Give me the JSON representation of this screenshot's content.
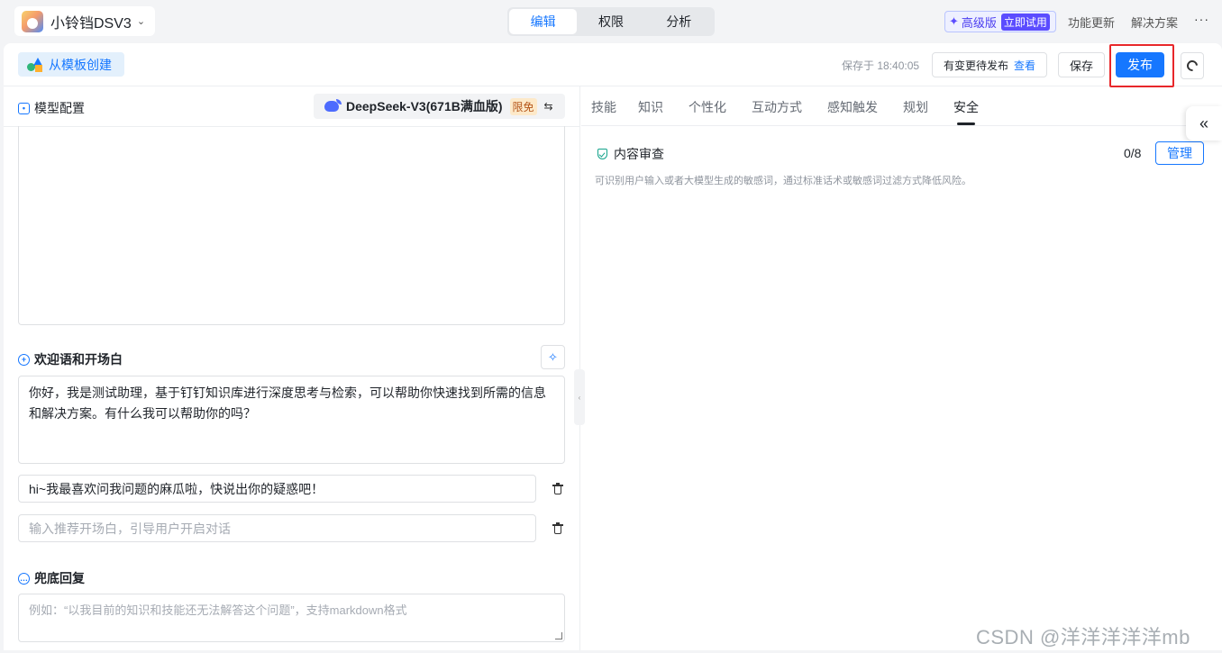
{
  "app": {
    "name": "小铃铛DSV3"
  },
  "mode_tabs": [
    {
      "label": "编辑",
      "active": true
    },
    {
      "label": "权限",
      "active": false
    },
    {
      "label": "分析",
      "active": false
    }
  ],
  "header": {
    "upgrade_label": "高级版",
    "upgrade_try": "立即试用",
    "links": [
      "功能更新",
      "解决方案"
    ],
    "more": "···"
  },
  "toolbar": {
    "template_label": "从模板创建",
    "saved_text": "保存于 18:40:05",
    "pending_text": "有变更待发布",
    "pending_link": "查看",
    "save_label": "保存",
    "publish_label": "发布"
  },
  "left": {
    "model_section_title": "模型配置",
    "model_name": "DeepSeek-V3(671B满血版)",
    "model_badge": "限免",
    "model_swap": "⇆",
    "welcome_title": "欢迎语和开场白",
    "welcome_text": "你好，我是测试助理，基于钉钉知识库进行深度思考与检索，可以帮助你快速找到所需的信息和解决方案。有什么我可以帮助你的吗？",
    "openers": [
      {
        "value": "hi~我最喜欢问我问题的麻瓜啦，快说出你的疑惑吧！",
        "placeholder": ""
      },
      {
        "value": "",
        "placeholder": "输入推荐开场白，引导用户开启对话"
      }
    ],
    "fallback_title": "兜底回复",
    "fallback_placeholder": "例如：“以我目前的知识和技能还无法解答这个问题”，支持markdown格式"
  },
  "right": {
    "tabs": [
      "技能",
      "知识",
      "个性化",
      "互动方式",
      "感知触发",
      "规划",
      "安全"
    ],
    "active_tab": "安全",
    "review_title": "内容审查",
    "review_desc": "可识别用户输入或者大模型生成的敏感词，通过标准话术或敏感词过滤方式降低风险。",
    "review_count": "0/8",
    "manage_label": "管理"
  },
  "watermark": "CSDN @洋洋洋洋洋mb",
  "colors": {
    "accent": "#1677ff",
    "highlight": "#e8272a",
    "upgrade": "#5b4cff",
    "safe": "#14a38b"
  }
}
